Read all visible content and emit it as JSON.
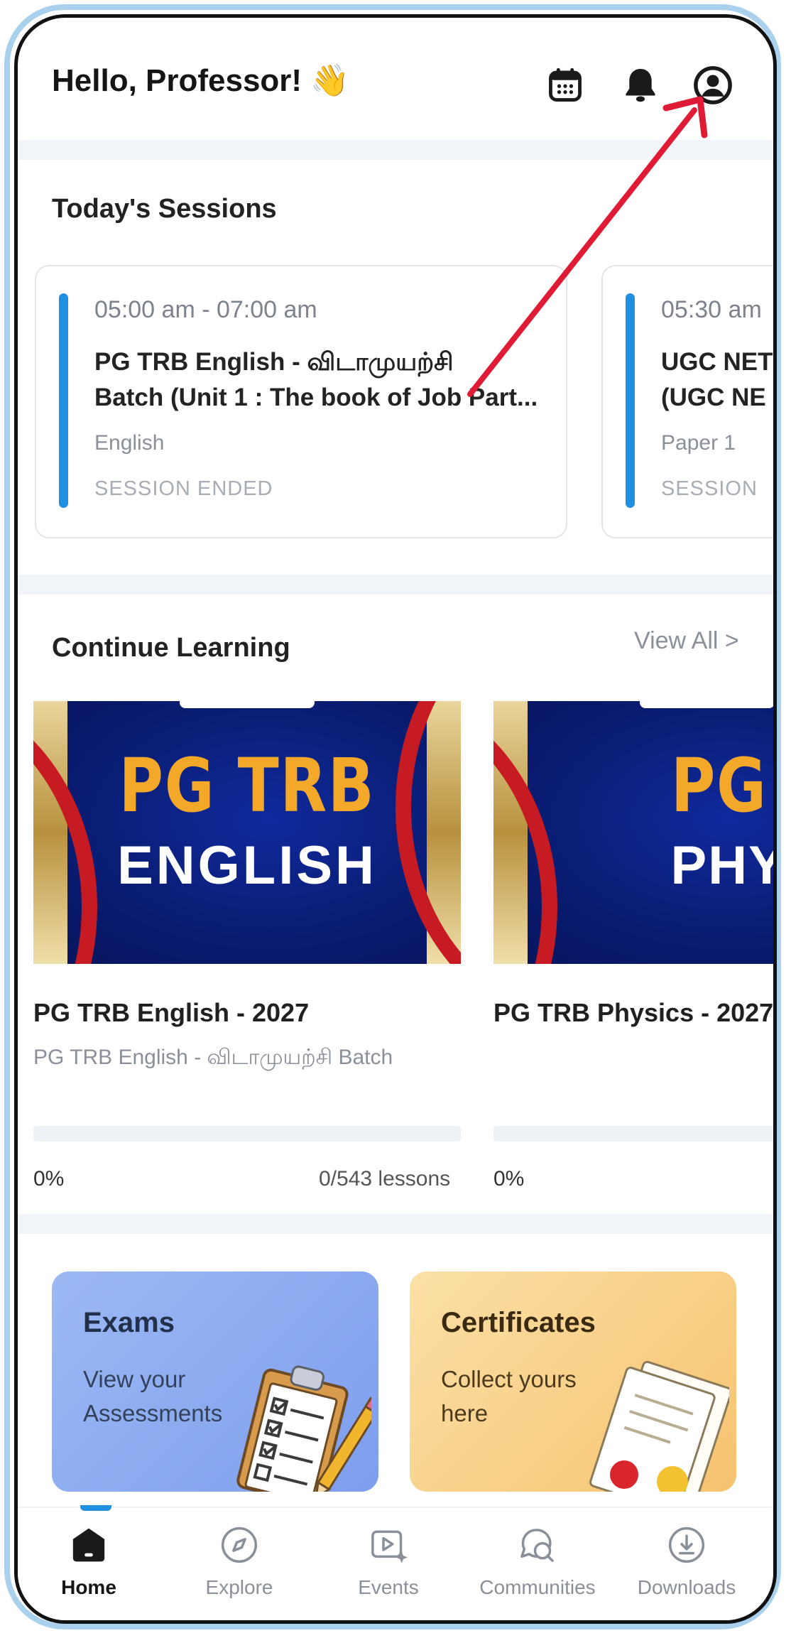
{
  "header": {
    "greeting": "Hello, Professor!",
    "wave_emoji": "👋",
    "icons": [
      "calendar-icon",
      "bell-icon",
      "profile-icon"
    ]
  },
  "sessions": {
    "title": "Today's Sessions",
    "items": [
      {
        "time": "05:00 am - 07:00 am",
        "title_line1": "PG TRB English - விடாமுயற்சி",
        "title_line2": "Batch  (Unit 1 : The book of Job Part...",
        "subject": "English",
        "status": "SESSION ENDED"
      },
      {
        "time": "05:30 am",
        "title_line1": "UGC NET",
        "title_line2": "(UGC NE",
        "subject": "Paper 1",
        "status": "SESSION"
      }
    ]
  },
  "continue_learning": {
    "title": "Continue Learning",
    "view_all": "View All  >",
    "courses": [
      {
        "thumb_line1": "PG TRB",
        "thumb_line2": "ENGLISH",
        "title": "PG TRB English - 2027",
        "batch": "PG TRB English - விடாமுயற்சி Batch",
        "progress": 0,
        "progress_label": "0%",
        "lessons": "0/543 lessons"
      },
      {
        "thumb_line1": "PG TR",
        "thumb_line2": "PHYSIC",
        "title": "PG TRB Physics - 2027",
        "progress": 0,
        "progress_label": "0%"
      }
    ]
  },
  "tiles": {
    "exams": {
      "title": "Exams",
      "subtitle": "View your Assessments"
    },
    "certificates": {
      "title": "Certificates",
      "subtitle": "Collect yours here"
    }
  },
  "nav": {
    "items": [
      {
        "label": "Home",
        "icon": "home-icon",
        "active": true
      },
      {
        "label": "Explore",
        "icon": "compass-icon",
        "active": false
      },
      {
        "label": "Events",
        "icon": "play-sparkle-icon",
        "active": false
      },
      {
        "label": "Communities",
        "icon": "chat-bubble-icon",
        "active": false
      },
      {
        "label": "Downloads",
        "icon": "download-icon",
        "active": false
      }
    ]
  },
  "colors": {
    "accent": "#1e8fe1",
    "annotation_arrow": "#e01b35",
    "thumb_navy": "#0b1f7a",
    "thumb_gold": "#f4a82a",
    "exams_tile": "#8eaef1",
    "certificates_tile": "#f8cf86"
  }
}
